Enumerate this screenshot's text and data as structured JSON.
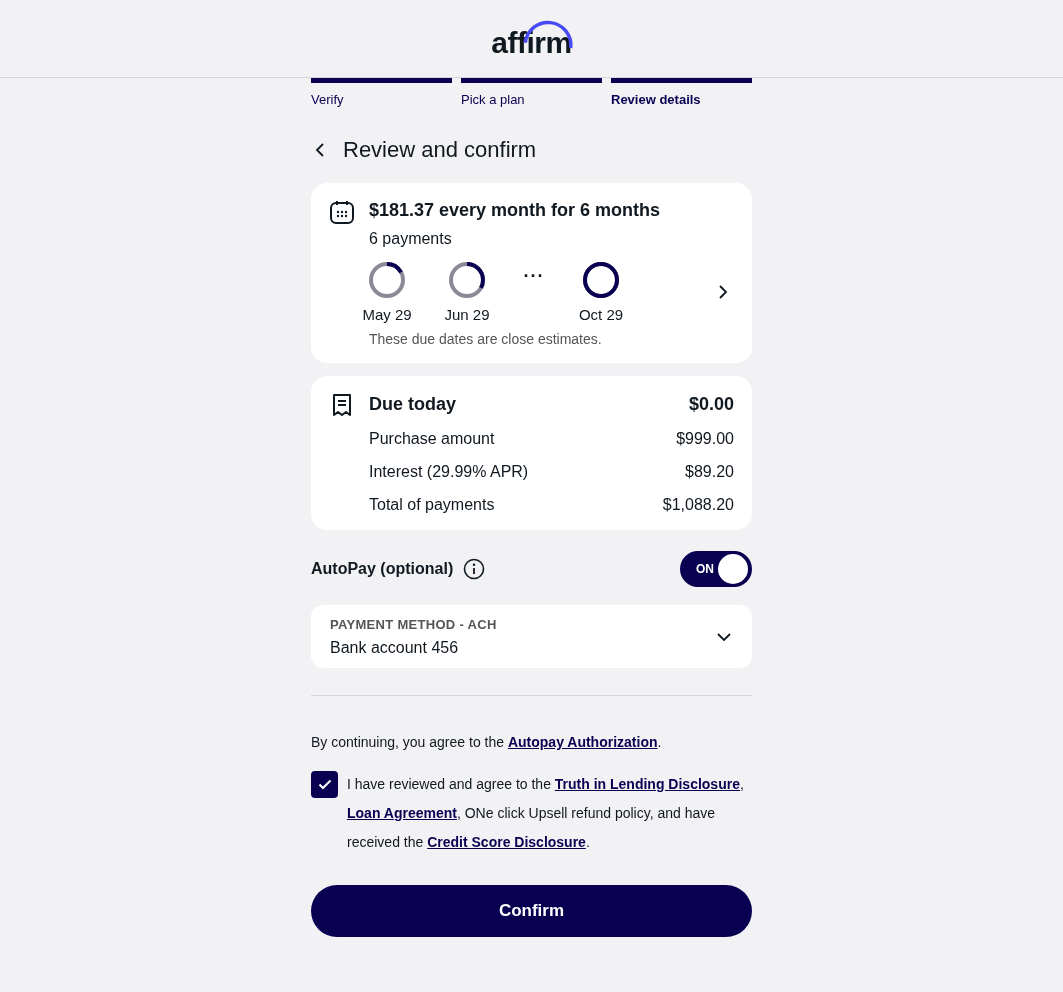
{
  "header": {
    "logo": "affirm"
  },
  "steps": [
    {
      "label": "Verify",
      "completed": true,
      "selected": false
    },
    {
      "label": "Pick a plan",
      "completed": true,
      "selected": false
    },
    {
      "label": "Review details",
      "completed": true,
      "selected": true
    }
  ],
  "title": "Review and confirm",
  "plan": {
    "headline": "$181.37 every month for 6 months",
    "subtitle": "6 payments",
    "payments": [
      {
        "kind": "ring",
        "date": "May 29",
        "level": 0.17
      },
      {
        "kind": "ring",
        "date": "Jun 29",
        "level": 0.33
      },
      {
        "kind": "ellipsis",
        "symbol": "···"
      },
      {
        "kind": "ring",
        "date": "Oct 29",
        "level": 1
      }
    ],
    "note": "These due dates are close estimates."
  },
  "due": {
    "label": "Due today",
    "amount": "$0.00",
    "rows": [
      {
        "label": "Purchase amount",
        "value": "$999.00"
      },
      {
        "label": "Interest (29.99% APR)",
        "value": "$89.20"
      },
      {
        "label": "Total of payments",
        "value": "$1,088.20"
      }
    ]
  },
  "autopay": {
    "label": "AutoPay (optional)",
    "on": true,
    "state_label": "ON"
  },
  "payment_method": {
    "label": "PAYMENT METHOD - ACH",
    "value": "Bank account 456"
  },
  "consent": [
    {
      "kind": "text",
      "text": "By continuing, you agree to the "
    },
    {
      "kind": "link",
      "text": "Autopay Authorization"
    },
    {
      "kind": "text",
      "text": "."
    }
  ],
  "agreement": {
    "checked": true,
    "parts": [
      {
        "kind": "text",
        "text": "I have reviewed and agree to the "
      },
      {
        "kind": "link",
        "text": "Truth in Lending Disclosure"
      },
      {
        "kind": "text",
        "text": ", "
      },
      {
        "kind": "link",
        "text": "Loan Agreement"
      },
      {
        "kind": "text",
        "text": ", ONe click Upsell refund policy, and have received the "
      },
      {
        "kind": "link",
        "text": "Credit Score Disclosure"
      },
      {
        "kind": "text",
        "text": "."
      }
    ]
  },
  "confirm_button": "Confirm"
}
